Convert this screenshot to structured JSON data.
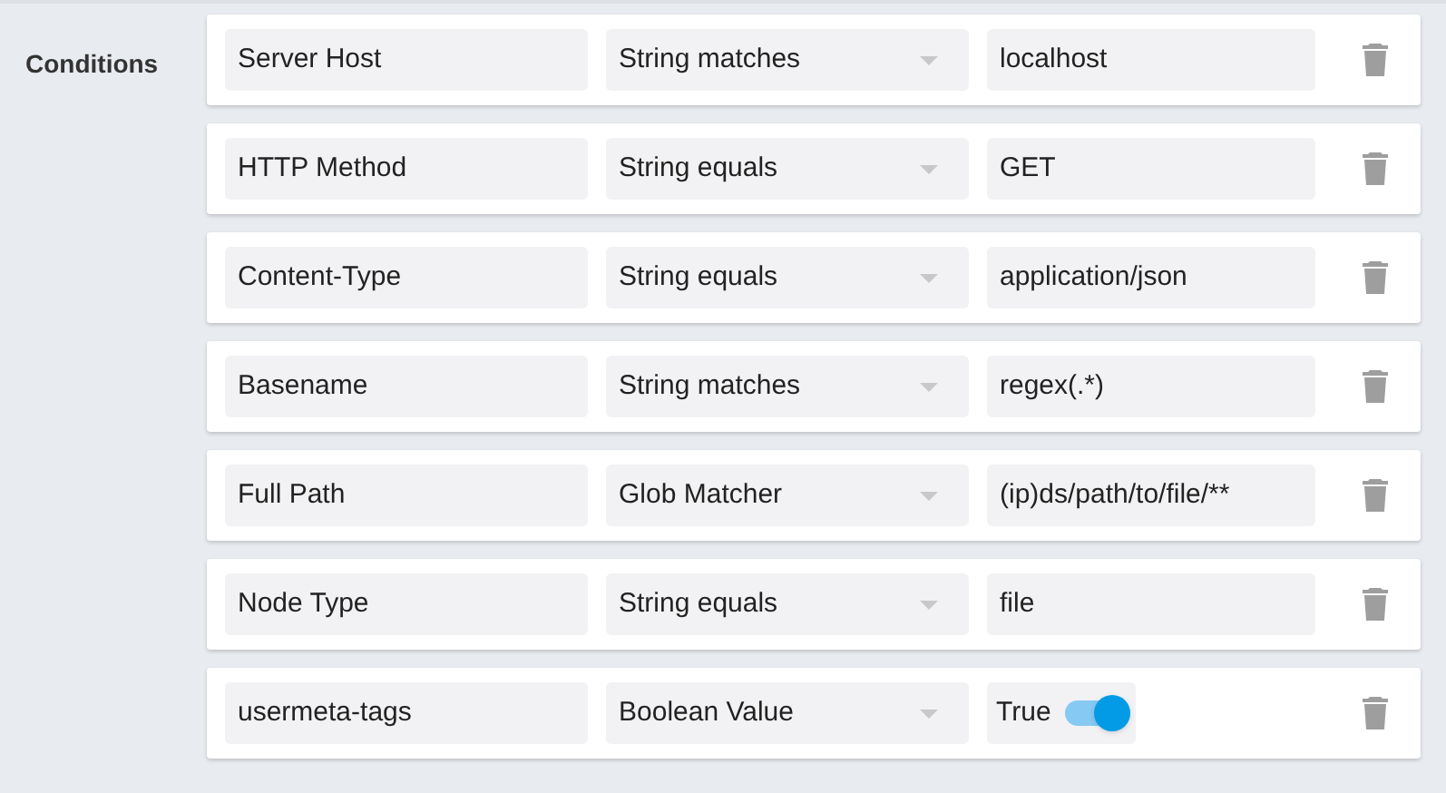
{
  "section_label": "Conditions",
  "conditions": [
    {
      "field": "Server Host",
      "operator": "String matches",
      "kind": "text",
      "value": "localhost"
    },
    {
      "field": "HTTP Method",
      "operator": "String equals",
      "kind": "text",
      "value": "GET"
    },
    {
      "field": "Content-Type",
      "operator": "String equals",
      "kind": "text",
      "value": "application/json"
    },
    {
      "field": "Basename",
      "operator": "String matches",
      "kind": "text",
      "value": "regex(.*)"
    },
    {
      "field": "Full Path",
      "operator": "Glob Matcher",
      "kind": "text",
      "value": "(ip)ds/path/to/file/**"
    },
    {
      "field": "Node Type",
      "operator": "String equals",
      "kind": "text",
      "value": "file"
    },
    {
      "field": "usermeta-tags",
      "operator": "Boolean Value",
      "kind": "toggle",
      "value": "True",
      "on": true
    }
  ]
}
